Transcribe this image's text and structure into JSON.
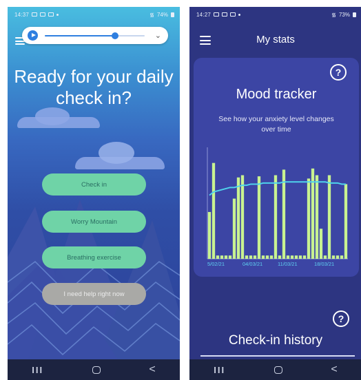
{
  "left_screen": {
    "status": {
      "time": "14:37",
      "battery": "74%"
    },
    "audio_player": {
      "progress": 0.7
    },
    "title": "Ready for your daily check in?",
    "buttons": {
      "check_in": "Check in",
      "worry_mountain": "Worry Mountain",
      "breathing_exercise": "Breathing exercise",
      "need_help": "I need help right now"
    }
  },
  "right_screen": {
    "status": {
      "time": "14:27",
      "battery": "73%"
    },
    "header_title": "My stats",
    "card": {
      "help_glyph": "?",
      "title": "Mood tracker",
      "subtitle": "See how your anxiety level changes over time"
    },
    "history": {
      "help_glyph": "?",
      "title": "Check-in history"
    }
  },
  "nav": {
    "recent_glyph": "III",
    "back_glyph": "<"
  },
  "colors": {
    "bar": "#c8f291",
    "trend_line": "#4fd4ec",
    "button_green": "#6fd3a7",
    "button_grey": "#a9a9a6",
    "card_bg": "#3c45a4",
    "screen_bg": "#2d3581"
  },
  "icons": [
    "play-icon",
    "chevron-down-icon",
    "menu-icon",
    "help-icon"
  ],
  "chart_data": {
    "type": "bar",
    "title": "Mood tracker",
    "x_tick_labels": [
      "5/02/21",
      "04/03/21",
      "11/03/21",
      "18/03/21"
    ],
    "ylim": [
      0,
      10
    ],
    "bar_values": [
      4.2,
      8.6,
      0.3,
      0.3,
      0.3,
      0.3,
      5.4,
      7.3,
      7.5,
      0.3,
      0.3,
      0.3,
      7.4,
      0.3,
      0.3,
      0.3,
      7.5,
      0.3,
      8.0,
      0.3,
      0.3,
      0.3,
      0.3,
      0.3,
      7.2,
      8.1,
      7.5,
      2.7,
      0.3,
      7.5,
      0.3,
      0.3,
      0.3,
      6.7
    ],
    "trend_values": [
      5.7,
      6.0,
      6.1,
      6.2,
      6.3,
      6.4,
      6.4,
      6.5,
      6.6,
      6.6,
      6.7,
      6.7,
      6.7,
      6.8,
      6.8,
      6.8,
      6.8,
      6.8,
      6.9,
      6.9,
      6.9,
      6.9,
      6.9,
      6.9,
      6.9,
      6.9,
      6.9,
      6.9,
      6.9,
      6.8,
      6.8,
      6.8,
      6.7,
      6.7
    ]
  }
}
